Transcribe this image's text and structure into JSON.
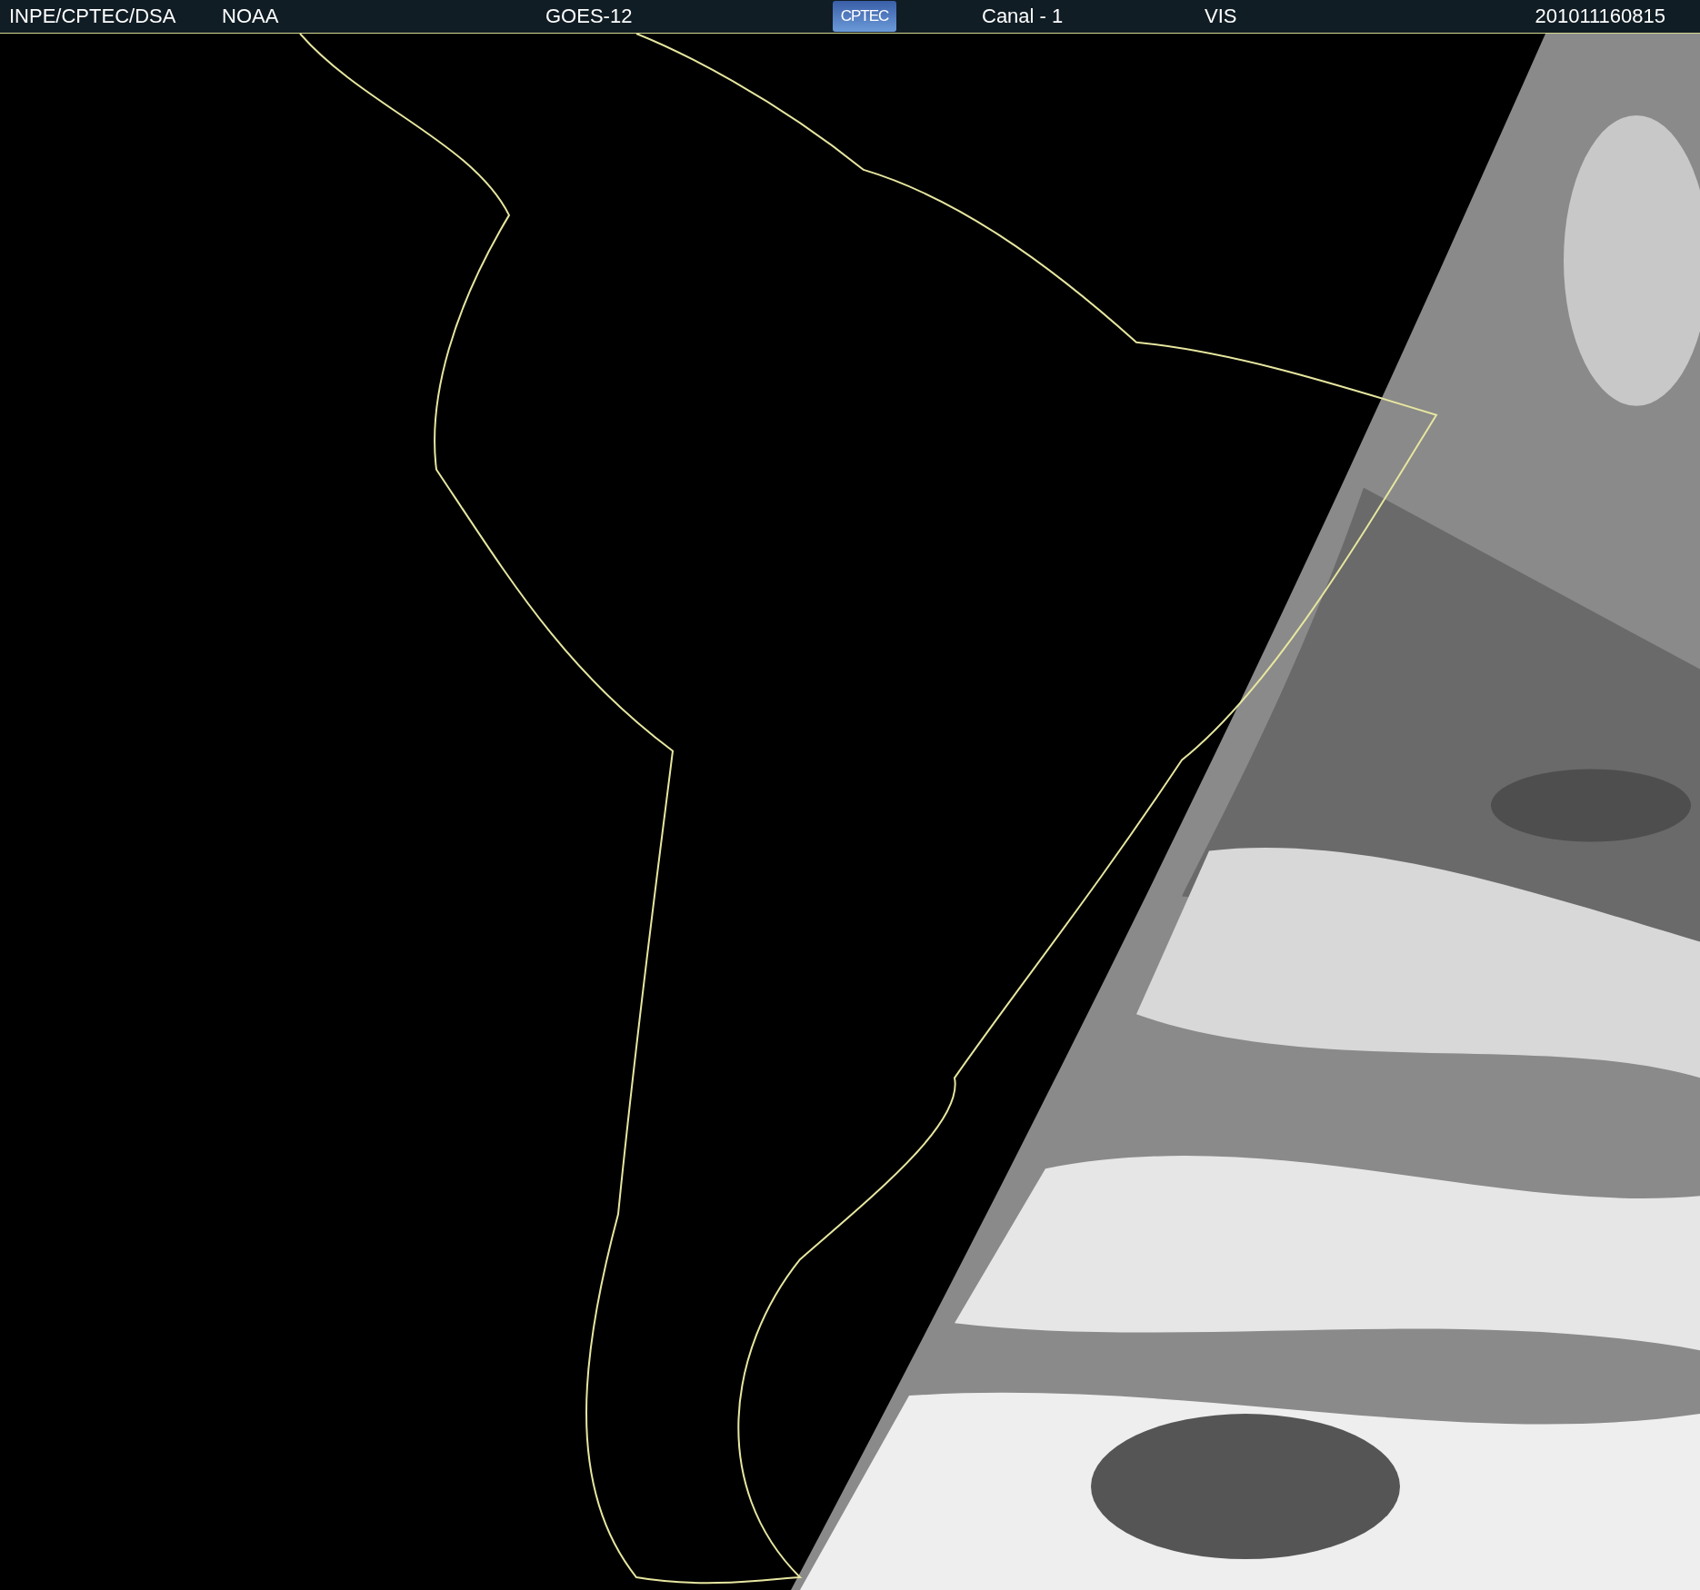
{
  "header": {
    "source": "INPE/CPTEC/DSA",
    "agency": "NOAA",
    "satellite": "GOES-12",
    "logo": "CPTEC",
    "channel": "Canal - 1",
    "band": "VIS",
    "timestamp": "201011160815"
  }
}
